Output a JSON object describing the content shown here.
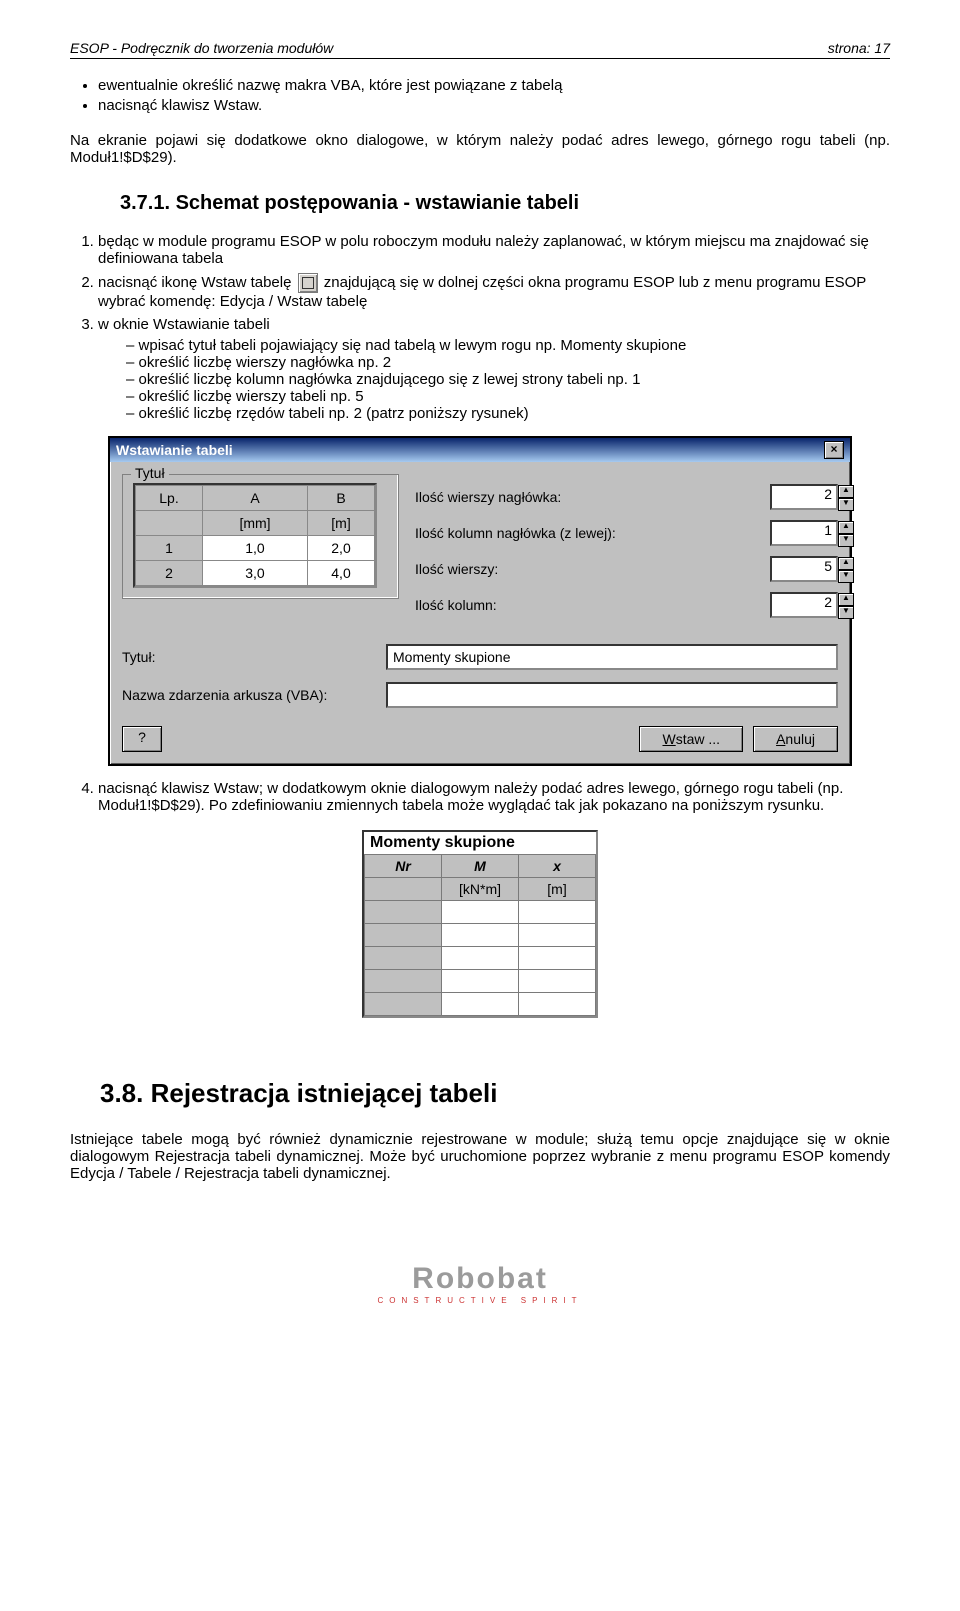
{
  "header": {
    "left": "ESOP - Podręcznik do tworzenia modułów",
    "right": "strona: 17"
  },
  "bullets": [
    "ewentualnie określić nazwę makra VBA, które jest powiązane z tabelą",
    "nacisnąć klawisz Wstaw."
  ],
  "post_bullet_para": "Na ekranie pojawi się dodatkowe okno dialogowe, w którym należy podać adres lewego, górnego rogu tabeli (np. Moduł1!$D$29).",
  "h371": "3.7.1.    Schemat postępowania - wstawianie tabeli",
  "step1": "będąc w module programu ESOP w polu roboczym modułu należy zaplanować, w którym miejscu ma znajdować się definiowana tabela",
  "step2a": "nacisnąć ikonę Wstaw tabelę ",
  "step2b": " znajdującą się w dolnej części okna programu ESOP lub z menu programu ESOP wybrać komendę: Edycja / Wstaw tabelę",
  "step3": "w oknie Wstawianie tabeli",
  "dashes": [
    "wpisać tytuł tabeli pojawiający się nad tabelą w lewym rogu np. Momenty skupione",
    "określić liczbę wierszy nagłówka np. 2",
    "określić liczbę kolumn nagłówka znajdującego się z lewej strony tabeli np. 1",
    "określić liczbę wierszy tabeli np. 5",
    "określić liczbę rzędów tabeli np. 2 (patrz poniższy rysunek)"
  ],
  "dlg": {
    "title": "Wstawianie tabeli",
    "groupbox": "Tytuł",
    "preview": {
      "head1": [
        "Lp.",
        "A",
        "B"
      ],
      "head2": [
        "",
        "[mm]",
        "[m]"
      ],
      "rows": [
        [
          "1",
          "1,0",
          "2,0"
        ],
        [
          "2",
          "3,0",
          "4,0"
        ]
      ]
    },
    "fields": [
      {
        "label": "Ilość wierszy nagłówka:",
        "value": "2"
      },
      {
        "label": "Ilość kolumn nagłówka (z lewej):",
        "value": "1"
      },
      {
        "label": "Ilość wierszy:",
        "value": "5"
      },
      {
        "label": "Ilość kolumn:",
        "value": "2"
      }
    ],
    "row_tytul_label": "Tytuł:",
    "row_tytul_value": "Momenty skupione",
    "row_vba_label": "Nazwa zdarzenia arkusza (VBA):",
    "row_vba_value": "",
    "help": "?",
    "wstaw": "Wstaw ...",
    "anuluj": "Anuluj"
  },
  "step4": "nacisnąć klawisz Wstaw; w dodatkowym oknie dialogowym należy podać adres lewego, górnego rogu tabeli (np. Moduł1!$D$29). Po zdefiniowaniu zmiennych tabela może wyglądać tak jak pokazano na poniższym rysunku.",
  "rtable": {
    "caption": "Momenty skupione",
    "head1": [
      "Nr",
      "M",
      "x"
    ],
    "head2": [
      "",
      "[kN*m]",
      "[m]"
    ],
    "empty_rows": 5
  },
  "h38": "3.8.  Rejestracja istniejącej tabeli",
  "para38": "Istniejące tabele mogą być również dynamicznie rejestrowane w module; służą temu opcje znajdujące się w oknie dialogowym Rejestracja tabeli dynamicznej. Może być uruchomione poprzez wybranie z menu programu ESOP komendy Edycja / Tabele / Rejestracja tabeli dynamicznej.",
  "logo": {
    "name": "Robobat",
    "sub": "CONSTRUCTIVE SPIRIT"
  }
}
